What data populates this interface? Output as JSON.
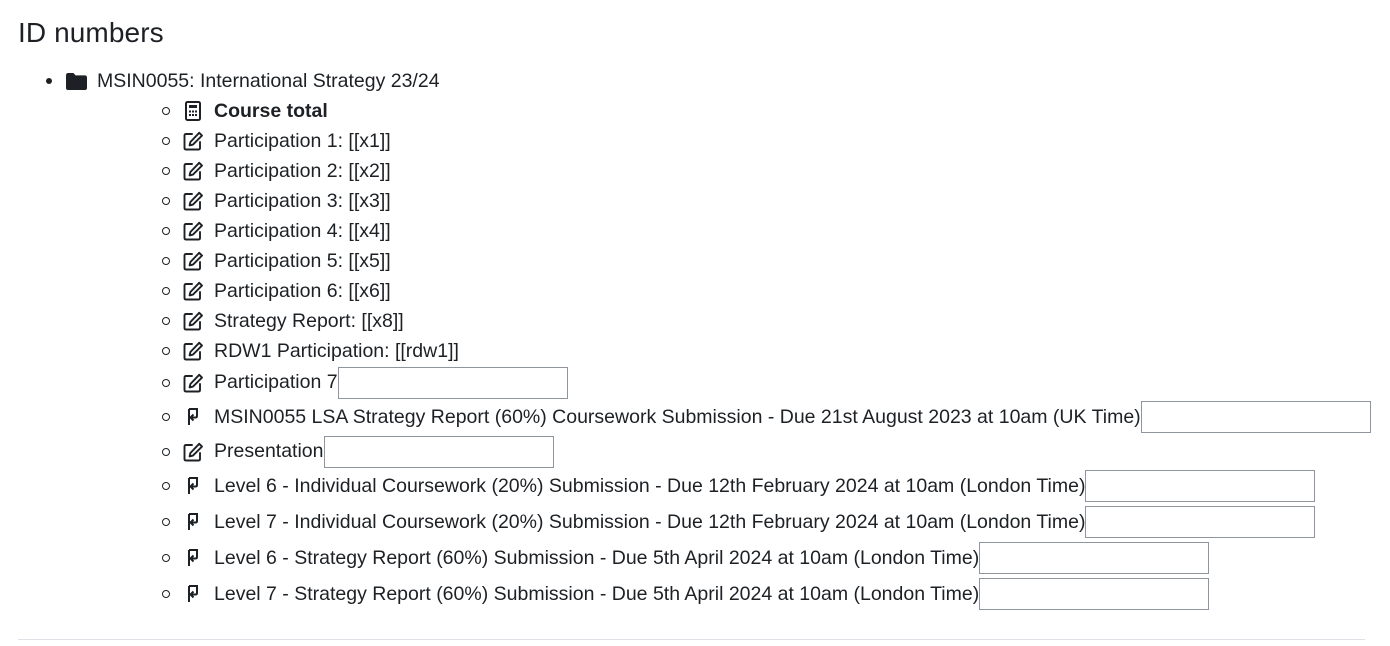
{
  "page": {
    "title": "ID numbers"
  },
  "course": {
    "label": "MSIN0055: International Strategy 23/24",
    "icon": "folder-icon"
  },
  "items": [
    {
      "label": "Course total",
      "icon": "calculator-icon",
      "bold": true,
      "input": false
    },
    {
      "label": "Participation 1: [[x1]]",
      "icon": "edit-icon",
      "input": false
    },
    {
      "label": "Participation 2: [[x2]]",
      "icon": "edit-icon",
      "input": false
    },
    {
      "label": "Participation 3: [[x3]]",
      "icon": "edit-icon",
      "input": false
    },
    {
      "label": "Participation 4: [[x4]]",
      "icon": "edit-icon",
      "input": false
    },
    {
      "label": "Participation 5: [[x5]]",
      "icon": "edit-icon",
      "input": false
    },
    {
      "label": "Participation 6: [[x6]]",
      "icon": "edit-icon",
      "input": false
    },
    {
      "label": "Strategy Report: [[x8]]",
      "icon": "edit-icon",
      "input": false
    },
    {
      "label": "RDW1 Participation: [[rdw1]]",
      "icon": "edit-icon",
      "input": false
    },
    {
      "label": "Participation 7",
      "icon": "edit-icon",
      "input": true,
      "value": ""
    },
    {
      "label": "MSIN0055 LSA Strategy Report (60%) Coursework Submission - Due 21st August 2023 at 10am (UK Time)",
      "icon": "assignment-icon",
      "input": true,
      "value": ""
    },
    {
      "label": "Presentation",
      "icon": "edit-icon",
      "input": true,
      "value": ""
    },
    {
      "label": "Level 6 - Individual Coursework (20%) Submission - Due 12th February 2024 at 10am (London Time)",
      "icon": "assignment-icon",
      "input": true,
      "value": ""
    },
    {
      "label": "Level 7 - Individual Coursework (20%) Submission - Due 12th February 2024 at 10am (London Time)",
      "icon": "assignment-icon",
      "input": true,
      "value": ""
    },
    {
      "label": "Level 6 - Strategy Report (60%) Submission - Due 5th April 2024 at 10am (London Time)",
      "icon": "assignment-icon",
      "input": true,
      "value": ""
    },
    {
      "label": "Level 7 - Strategy Report (60%) Submission - Due 5th April 2024 at 10am (London Time)",
      "icon": "assignment-icon",
      "input": true,
      "value": ""
    }
  ]
}
